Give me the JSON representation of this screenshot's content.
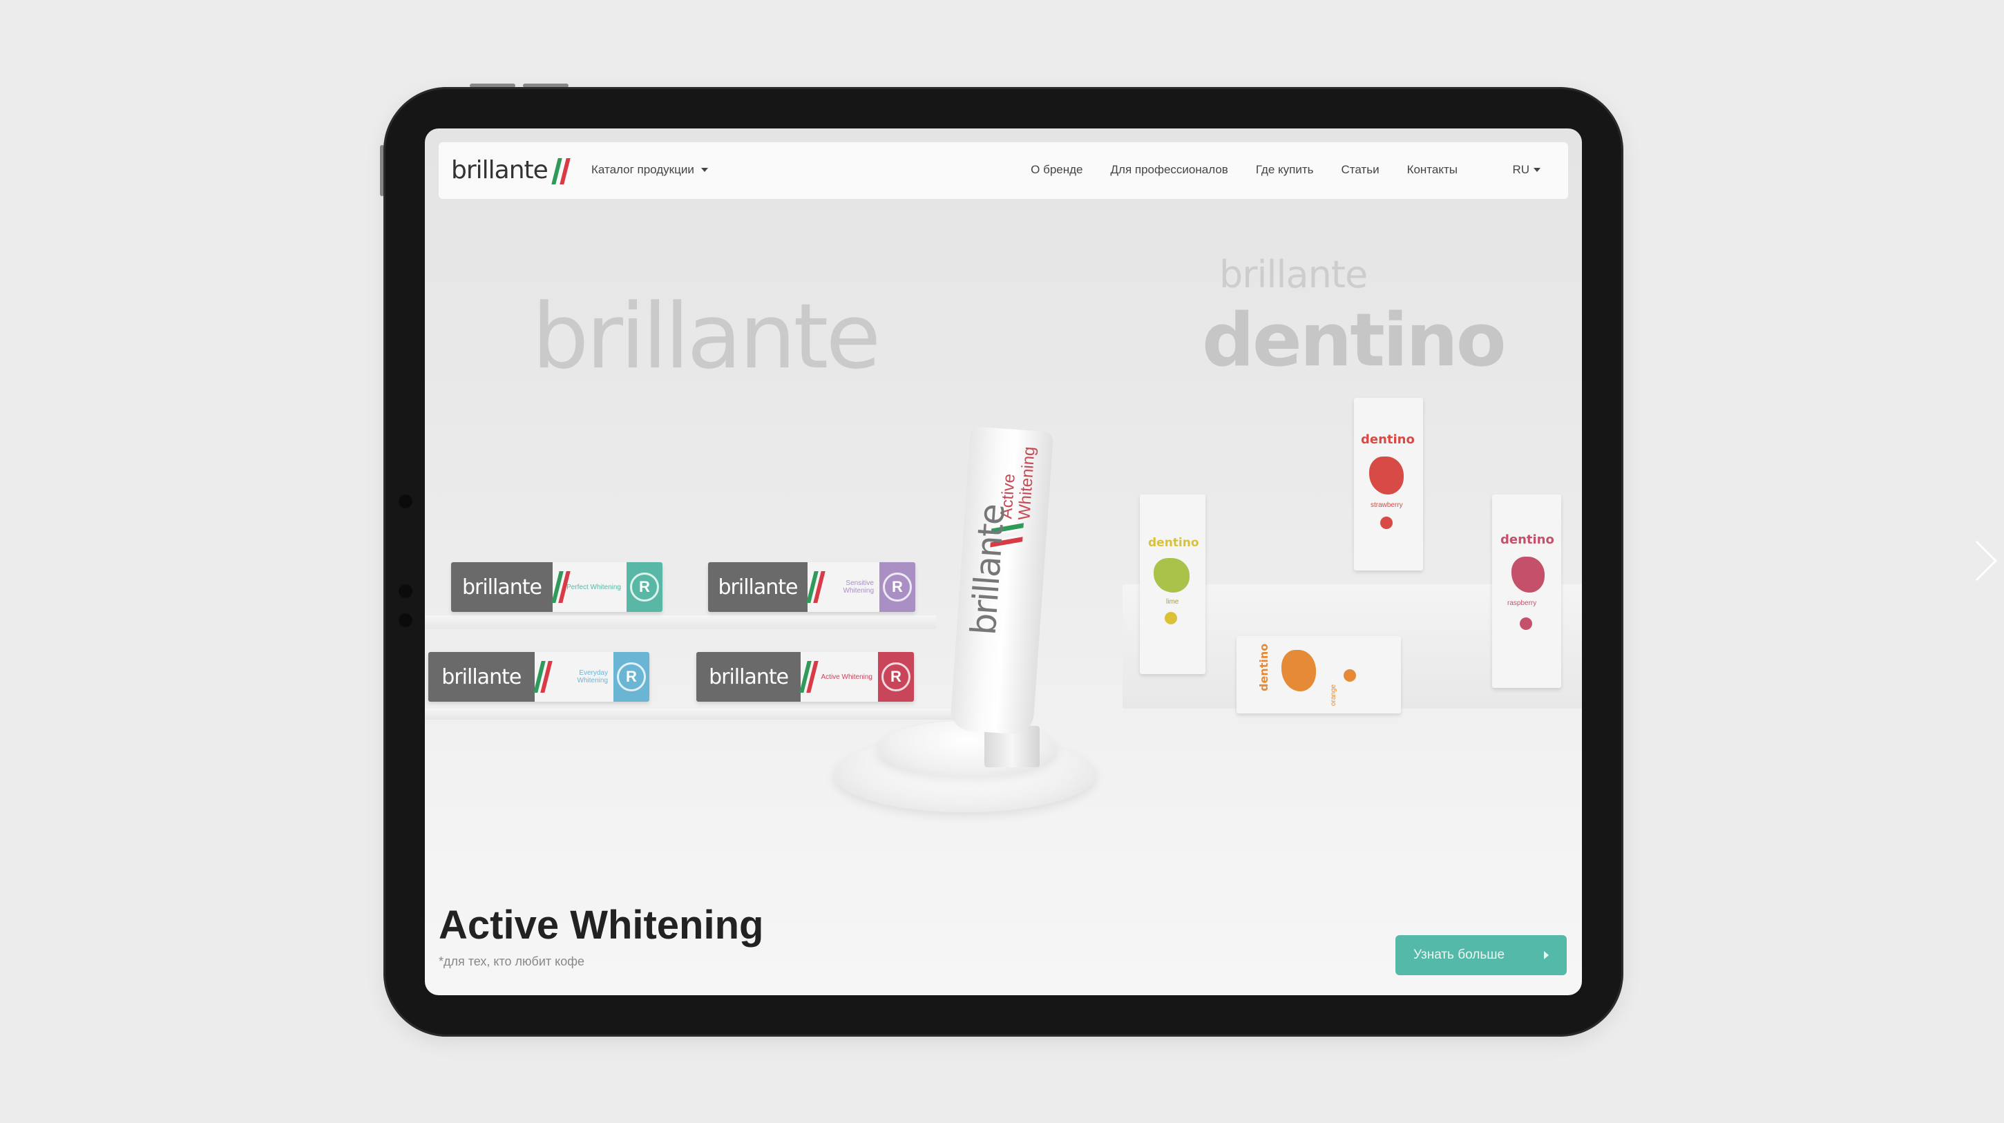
{
  "brand": {
    "logo_text": "brillante",
    "stripe_colors": [
      "#2f9a5a",
      "#d93b46"
    ]
  },
  "nav": {
    "catalog_label": "Каталог продукции",
    "links": [
      "О бренде",
      "Для профессионалов",
      "Где купить",
      "Статьи",
      "Контакты"
    ],
    "language": "RU"
  },
  "scene": {
    "bg_brand_left": "brillante",
    "bg_brand_right": "brillante",
    "bg_sub_brand": "dentino",
    "boxes": [
      {
        "brand": "brillante",
        "name": "Perfect Whitening",
        "color": "#58b8a5"
      },
      {
        "brand": "brillante",
        "name": "Sensitive Whitening",
        "color": "#a98fc4"
      },
      {
        "brand": "brillante",
        "name": "Everyday Whitening",
        "color": "#6bb5d4"
      },
      {
        "brand": "brillante",
        "name": "Active Whitening",
        "color": "#c9455a"
      }
    ],
    "tube": {
      "brand": "brillante",
      "name_line1": "Active",
      "name_line2": "Whitening"
    },
    "kids": [
      {
        "label": "dentino",
        "flavor": "strawberry",
        "color": "#d84a45"
      },
      {
        "label": "dentino",
        "flavor": "lime",
        "color": "#d9c237"
      },
      {
        "label": "dentino",
        "flavor": "raspberry",
        "color": "#c4506a"
      },
      {
        "label": "dentino",
        "flavor": "orange",
        "color": "#e58a36"
      }
    ]
  },
  "hero": {
    "title": "Active Whitening",
    "note": "*для тех, кто любит кофе",
    "cta_label": "Узнать больше"
  },
  "colors": {
    "cta": "#55b9a9",
    "device_frame": "#161616",
    "background": "#ececec"
  }
}
